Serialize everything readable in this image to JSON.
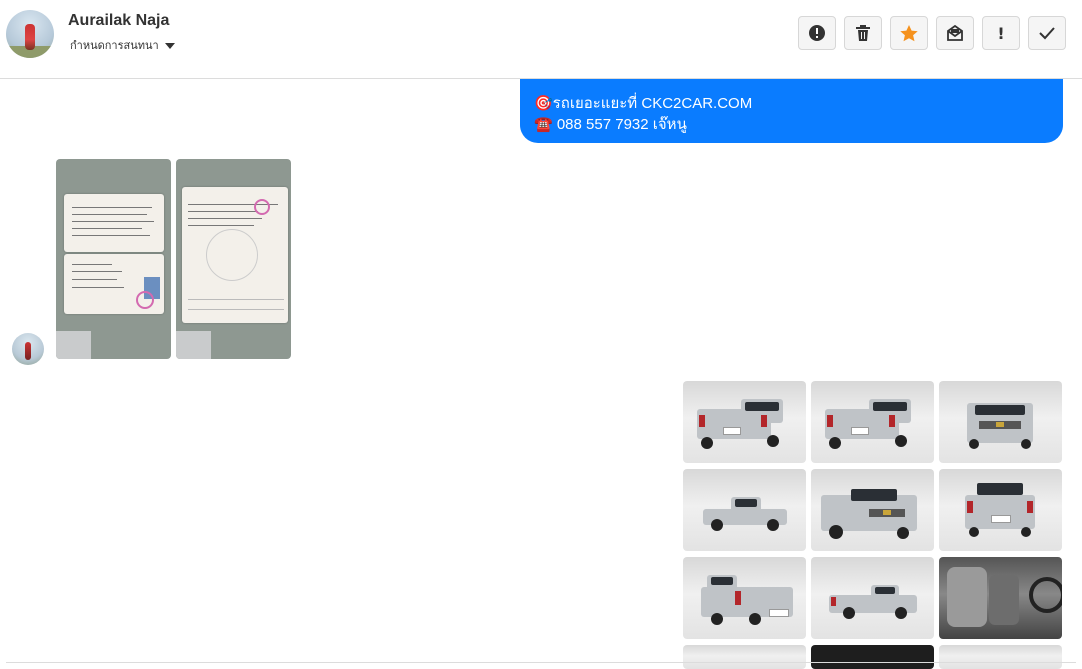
{
  "header": {
    "contact_name": "Aurailak Naja",
    "assign_label": "กำหนดการสนทนา",
    "actions": [
      {
        "name": "report-button",
        "icon": "alert-circle-icon"
      },
      {
        "name": "delete-button",
        "icon": "trash-icon"
      },
      {
        "name": "star-button",
        "icon": "star-icon"
      },
      {
        "name": "mark-unread-button",
        "icon": "envelope-icon"
      },
      {
        "name": "important-button",
        "icon": "exclamation-icon"
      },
      {
        "name": "done-button",
        "icon": "check-icon"
      }
    ]
  },
  "messages": {
    "outgoing_bubble": {
      "line1": "🎯รถเยอะแยะที่ CKC2CAR.COM",
      "line2": "☎️ 088 557 7932 เจ๊หนู"
    },
    "incoming_images": [
      "document-photo-1",
      "document-photo-2"
    ],
    "car_grid_count": 12
  },
  "colors": {
    "bubble_blue": "#0a7cff",
    "star_orange": "#f5921e"
  }
}
